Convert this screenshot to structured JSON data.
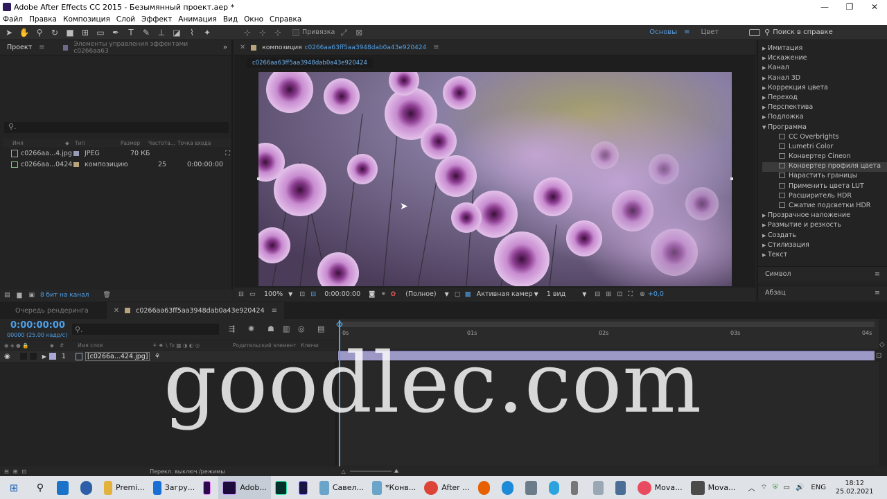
{
  "window": {
    "title": "Adobe After Effects CC 2015 - Безымянный проект.aep *",
    "min": "—",
    "max": "❐",
    "close": "✕"
  },
  "menu": [
    "Файл",
    "Правка",
    "Композиция",
    "Слой",
    "Эффект",
    "Анимация",
    "Вид",
    "Окно",
    "Справка"
  ],
  "toolbar": {
    "snap_label": "Привязка",
    "workspaces": [
      "Основы",
      "Цвет"
    ],
    "help_search": "Поиск в справке"
  },
  "project": {
    "tab": "Проект",
    "effects_tab": "Элементы управления эффектами c0266aa63",
    "columns": [
      "Имя",
      "Тип",
      "Размер",
      "Частота...",
      "Точка входа"
    ],
    "items": [
      {
        "name": "c0266aa...4.jpg",
        "type": "JPEG",
        "size": "70 КБ",
        "rate": "",
        "in": ""
      },
      {
        "name": "c0266aa...0424",
        "type": "композицию",
        "size": "",
        "rate": "25",
        "in": "0:00:00:00"
      }
    ],
    "bit_depth": "8 бит на канал"
  },
  "comp": {
    "panel_label": "композиция",
    "comp_name": "c0266aa63ff5aa3948dab0a43e920424",
    "tab": "c0266aa63ff5aa3948dab0a43e920424",
    "zoom": "100%",
    "timecode": "0:00:00:00",
    "resolution": "(Полное)",
    "camera": "Активная камер",
    "views": "1 вид",
    "exposure": "+0,0"
  },
  "effects": {
    "top": [
      "Имитация",
      "Искажение",
      "Канал",
      "Канал 3D",
      "Коррекция цвета",
      "Переход",
      "Перспектива",
      "Подложка",
      "Программа"
    ],
    "program_items": [
      "CC Overbrights",
      "Lumetri Color",
      "Конвертер Cineon",
      "Конвертер профиля цвета",
      "Нарастить границы",
      "Применить цвета LUT",
      "Расширитель HDR",
      "Сжатие подсветки HDR"
    ],
    "selected": "Конвертер профиля цвета",
    "bottom": [
      "Прозрачное наложение",
      "Размытие и резкость",
      "Создать",
      "Стилизация",
      "Текст"
    ],
    "panels": [
      "Символ",
      "Абзац"
    ]
  },
  "timeline": {
    "render_queue": "Очередь рендеринга",
    "comp_tab": "c0266aa63ff5aa3948dab0a43e920424",
    "timecode": "0:00:00:00",
    "fps": "00000 (25.00 кадр/с)",
    "headers": [
      "Имя слоя",
      "Родительский элемент",
      "Ключи"
    ],
    "layer": {
      "num": "1",
      "name": "[c0266a...424.jpg]"
    },
    "ruler": [
      "0s",
      "01s",
      "02s",
      "03s",
      "04s"
    ],
    "footer": "Перекл. выключ./режимы"
  },
  "watermark": "goodlec.com",
  "taskbar": {
    "apps": [
      "Premi...",
      "Загру...",
      "",
      "Adob...",
      "",
      "",
      "Савел...",
      "*Конв...",
      "After ...",
      "",
      "",
      "",
      "",
      "",
      "Mova...",
      "Mova..."
    ],
    "lang": "ENG",
    "time": "18:12",
    "date": "25.02.2021"
  }
}
